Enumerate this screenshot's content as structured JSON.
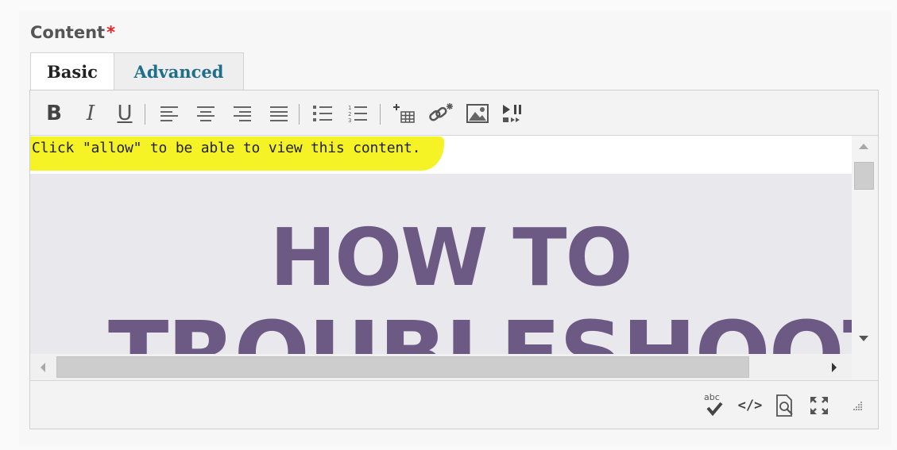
{
  "field": {
    "label": "Content",
    "required_mark": "*"
  },
  "tabs": [
    {
      "label": "Basic",
      "active": true
    },
    {
      "label": "Advanced",
      "active": false
    }
  ],
  "toolbar": {
    "bold": "B",
    "italic": "I",
    "underline": "U",
    "icons": [
      "bold-icon",
      "italic-icon",
      "underline-icon",
      "align-left-icon",
      "align-center-icon",
      "align-right-icon",
      "justify-icon",
      "bulleted-list-icon",
      "numbered-list-icon",
      "insert-table-icon",
      "insert-link-icon",
      "insert-image-icon",
      "insert-media-icon"
    ]
  },
  "content": {
    "notice": "Click \"allow\" to be able to view this content.",
    "preview_line1": "HOW TO",
    "preview_line2": "TROUBLESHOOT"
  },
  "bottom_toolbar": {
    "spellcheck_label": "abc",
    "source_code_label": "</>",
    "icons": [
      "spellcheck-icon",
      "source-code-icon",
      "preview-icon",
      "fullscreen-icon",
      "resize-grip-icon"
    ]
  },
  "colors": {
    "highlight": "#f5f225",
    "preview_text": "#6d5a84",
    "preview_bg": "#e9e8ec",
    "advanced_tab": "#1f6e8a",
    "required": "#e0242b"
  }
}
